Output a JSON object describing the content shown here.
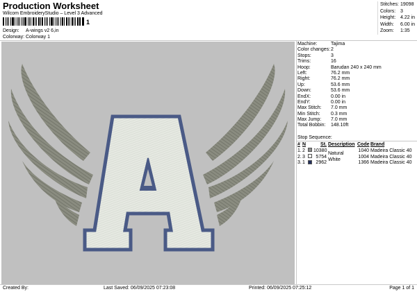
{
  "header": {
    "title": "Production Worksheet",
    "subtitle": "Wilcom EmbroideryStudio – Level 3 Advanced",
    "barcode_mark": "1",
    "design_label": "Design:",
    "design_value": "A-wings v2 6,in",
    "colorway_label": "Colorway:",
    "colorway_value": "Colorway 1"
  },
  "stats": [
    {
      "label": "Stitches:",
      "value": "19098"
    },
    {
      "label": "Colors:",
      "value": "3"
    },
    {
      "label": "Height:",
      "value": "4.22 in"
    },
    {
      "label": "Width:",
      "value": "6.00 in"
    },
    {
      "label": "Zoom:",
      "value": "1:35"
    }
  ],
  "specs": [
    {
      "label": "Machine:",
      "value": "Tajima"
    },
    {
      "label": "Color changes:",
      "value": "2"
    },
    {
      "label": "Stops:",
      "value": "3"
    },
    {
      "label": "Trims:",
      "value": "16"
    },
    {
      "label": "Hoop:",
      "value": "Barudan 240 x 240 mm"
    },
    {
      "label": "Left:",
      "value": "76.2 mm"
    },
    {
      "label": "Right:",
      "value": "76.2 mm"
    },
    {
      "label": "Up:",
      "value": "53.6 mm"
    },
    {
      "label": "Down:",
      "value": "53.6 mm"
    },
    {
      "label": "EndX:",
      "value": "0.00 in"
    },
    {
      "label": "EndY:",
      "value": "0.00 in"
    },
    {
      "label": "Max Stitch:",
      "value": "7.0 mm"
    },
    {
      "label": "Min Stitch:",
      "value": "0.3 mm"
    },
    {
      "label": "Max Jump:",
      "value": "7.0 mm"
    },
    {
      "label": "Total Bobbin:",
      "value": "148.10ft"
    }
  ],
  "sequence": {
    "title": "Stop Sequence:",
    "headers": {
      "num": "#",
      "n": "N",
      "st": "St.",
      "desc": "Description",
      "code": "Code",
      "brand": "Brand"
    },
    "rows": [
      {
        "idx": "1.",
        "n": "2",
        "color": "#8c8c8c",
        "st": "10380",
        "desc": "",
        "code": "1040",
        "brand": "Madeira Classic 40"
      },
      {
        "idx": "2.",
        "n": "3",
        "color": "#f2f2ee",
        "st": "5754",
        "desc": "Natural White",
        "code": "1004",
        "brand": "Madeira Classic 40"
      },
      {
        "idx": "3.",
        "n": "1",
        "color": "#24305e",
        "st": "2962",
        "desc": "",
        "code": "1366",
        "brand": "Madeira Classic 40"
      }
    ]
  },
  "footer": {
    "created": "Created By:",
    "saved": "Last Saved: 06/09/2025 07:23:08",
    "printed": "Printed: 06/09/2025 07:25:12",
    "page": "Page 1 of 1"
  },
  "colors": {
    "wing": "#8a8c80",
    "letter_fill": "#e6e9e2",
    "letter_outline": "#4a5a86",
    "canvas_bg": "#c0c0c0"
  }
}
